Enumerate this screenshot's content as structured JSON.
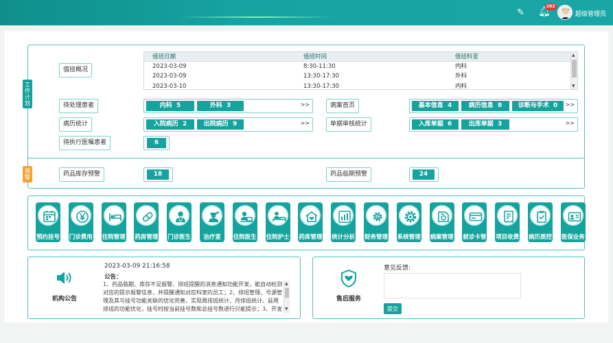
{
  "header": {
    "badge_count": "202",
    "username": "超级管理员"
  },
  "work_plan": {
    "tag": "工作计划",
    "duty_overview": "值班概况",
    "duty_table": {
      "columns": [
        "值班日期",
        "值班时间",
        "值班科室"
      ],
      "rows": [
        [
          "2023-03-09",
          "8:30-11:30",
          "内科"
        ],
        [
          "2023-03-09",
          "13:30-17:30",
          "外科"
        ],
        [
          "2023-03-10",
          "13:30-17:30",
          "内科"
        ]
      ]
    },
    "pending_patients": {
      "label": "待处理患者",
      "chips": [
        {
          "text": "内科",
          "count": "5"
        },
        {
          "text": "外科",
          "count": "3"
        }
      ],
      "more": ">>"
    },
    "record_home": {
      "label": "病案首页",
      "chips": [
        {
          "text": "基本信息",
          "count": "4"
        },
        {
          "text": "病历信息",
          "count": "8"
        },
        {
          "text": "诊断与手术",
          "count": "0"
        }
      ],
      "more": ">>"
    },
    "record_stats": {
      "label": "病历统计",
      "chips": [
        {
          "text": "入院病历",
          "count": "2"
        },
        {
          "text": "出院病历",
          "count": "9"
        }
      ],
      "more": ">>"
    },
    "doc_review": {
      "label": "单据审核统计",
      "chips": [
        {
          "text": "入库单据",
          "count": "6"
        },
        {
          "text": "出库单据",
          "count": "3"
        }
      ],
      "more": ">>"
    },
    "pending_orders": {
      "label": "待执行医嘱患者",
      "count": "6"
    }
  },
  "warning": {
    "tag": "预警",
    "stock_label": "药品库存预警",
    "stock_count": "18",
    "expiry_label": "药品临期预警",
    "expiry_count": "24"
  },
  "modules": [
    {
      "label": "预约挂号",
      "icon": "calendar-icon"
    },
    {
      "label": "门诊费用",
      "icon": "yen-icon"
    },
    {
      "label": "住院管理",
      "icon": "bed-icon"
    },
    {
      "label": "药房管理",
      "icon": "pill-icon"
    },
    {
      "label": "门诊医生",
      "icon": "doctor-icon"
    },
    {
      "label": "治疗室",
      "icon": "nurse-icon"
    },
    {
      "label": "住院医生",
      "icon": "doctor-desk-icon"
    },
    {
      "label": "住院护士",
      "icon": "nurse-bed-icon"
    },
    {
      "label": "药库管理",
      "icon": "warehouse-icon"
    },
    {
      "label": "统计分析",
      "icon": "bar-chart-icon"
    },
    {
      "label": "财务管理",
      "icon": "gear-coin-icon"
    },
    {
      "label": "系统管理",
      "icon": "gear-icon"
    },
    {
      "label": "病案管理",
      "icon": "folder-icon"
    },
    {
      "label": "就诊卡管",
      "icon": "card-icon"
    },
    {
      "label": "项目收费",
      "icon": "receipt-icon"
    },
    {
      "label": "病历质控",
      "icon": "clipboard-icon"
    },
    {
      "label": "医保业务",
      "icon": "id-card-icon"
    }
  ],
  "announcement": {
    "title": "机构公告",
    "datetime": "2023-03-09 21:16:58",
    "heading": "公告：",
    "body": "1、药品临期、库存不足报警、排班提醒的消息通知功能开发，能自动检测对应的提示报警信息，并提醒通知对应科室的员工；2、排班管理、号源管理及其与挂号功能关联的优化完善，实现周排班统计、月排班统计、延用排班的功能优化，挂号时按当前挂号数和总挂号数进行只能提示；3、开发"
  },
  "after_sales": {
    "title": "售后服务",
    "feedback_label": "意见反馈:",
    "feedback_value": "",
    "submit": "提交"
  },
  "colors": {
    "primary": "#14a39d",
    "warning": "#f3a331",
    "badge": "#e8373a"
  }
}
